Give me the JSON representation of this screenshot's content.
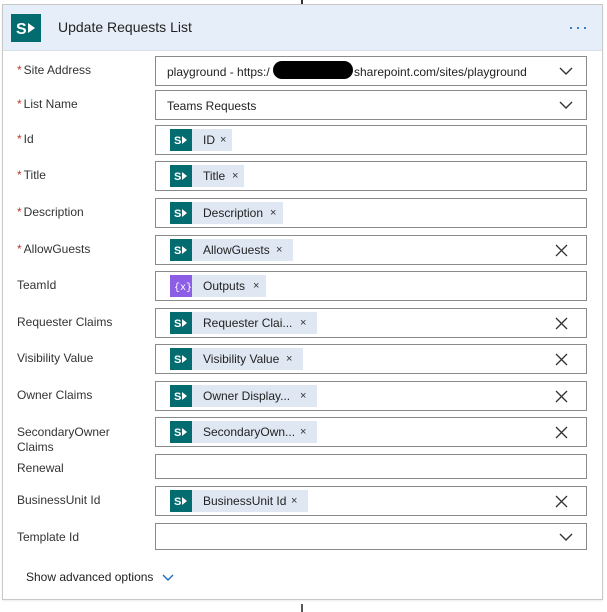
{
  "header": {
    "title": "Update Requests List",
    "more_label": "···"
  },
  "fields": [
    {
      "label": "Site Address",
      "required": true,
      "value_prefix": "playground - https:/",
      "value_suffix": "sharepoint.com/sites/playground"
    },
    {
      "label": "List Name",
      "required": true,
      "value": "Teams Requests"
    },
    {
      "label": "Id",
      "required": true,
      "token": "ID"
    },
    {
      "label": "Title",
      "required": true,
      "token": "Title"
    },
    {
      "label": "Description",
      "required": true,
      "token": "Description"
    },
    {
      "label": "AllowGuests",
      "required": true,
      "token": "AllowGuests"
    },
    {
      "label": "TeamId",
      "required": false,
      "token": "Outputs"
    },
    {
      "label": "Requester Claims",
      "required": false,
      "token": "Requester Clai..."
    },
    {
      "label": "Visibility Value",
      "required": false,
      "token": "Visibility Value"
    },
    {
      "label": "Owner Claims",
      "required": false,
      "token": "Owner Display..."
    },
    {
      "label": "SecondaryOwner Claims",
      "required": false,
      "token": "SecondaryOwn..."
    },
    {
      "label": "Renewal",
      "required": false,
      "value": ""
    },
    {
      "label": "BusinessUnit Id",
      "required": false,
      "token": "BusinessUnit Id"
    },
    {
      "label": "Template Id",
      "required": false,
      "value": ""
    }
  ],
  "required_marker": "*",
  "token_remove": "×",
  "advanced": {
    "label": "Show advanced options"
  },
  "colors": {
    "sharepoint": "#036c70",
    "expression": "#8c5ee6",
    "accent": "#1f6cc4",
    "header_bg": "#e5eef9",
    "required": "#c0392b"
  }
}
